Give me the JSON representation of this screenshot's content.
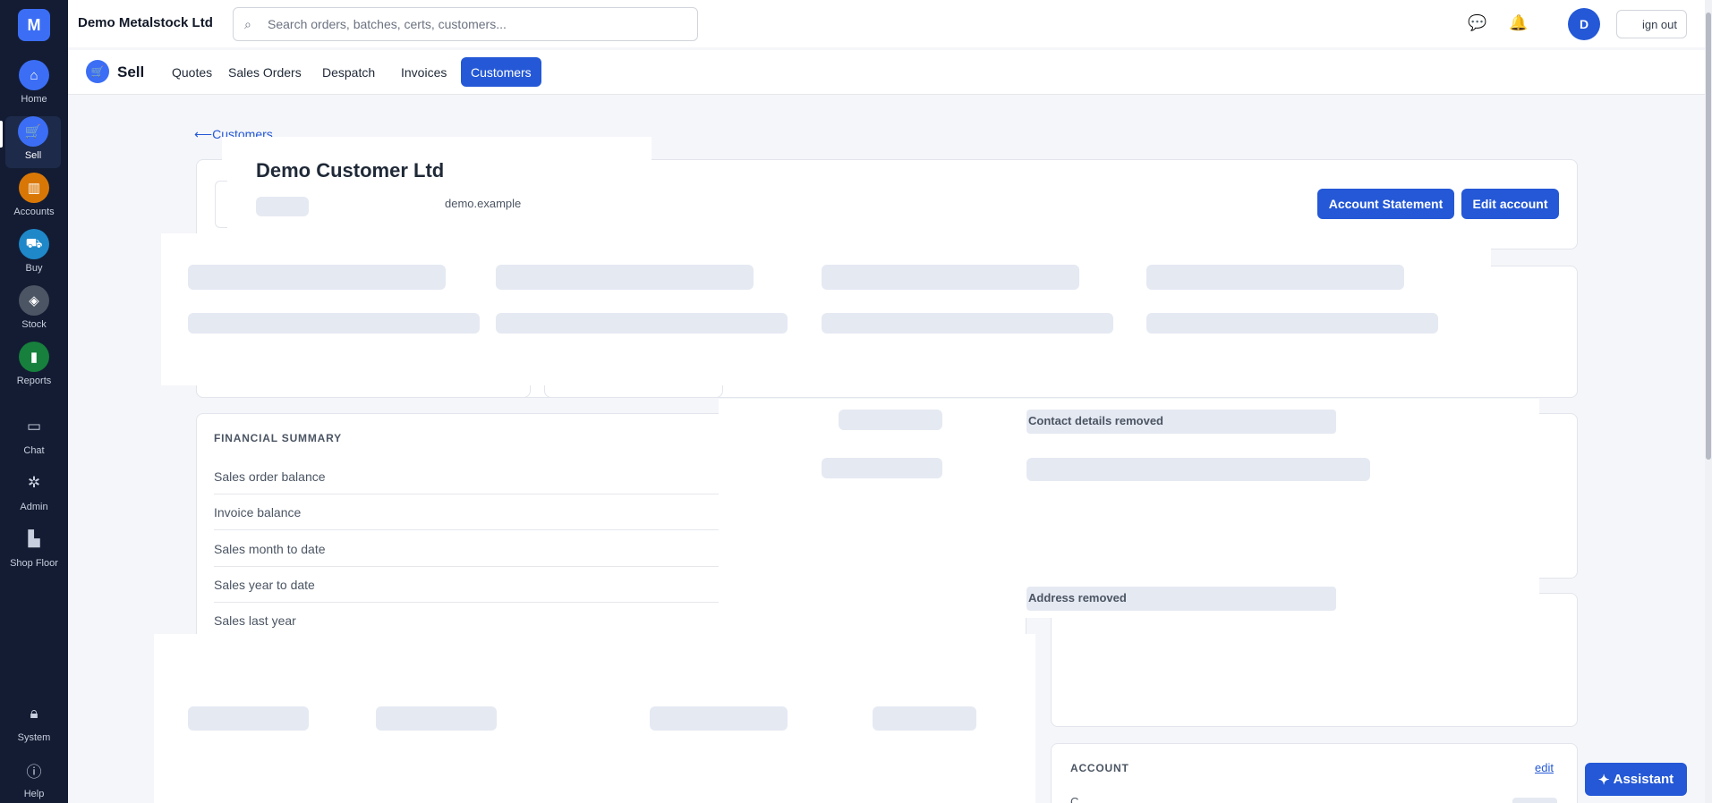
{
  "header": {
    "company": "Demo Metalstock Ltd",
    "search_placeholder": "Search orders, batches, certs, customers...",
    "avatar_initial": "D",
    "sign_out": "ign out"
  },
  "rail": {
    "brand": "M",
    "items": [
      {
        "label": "Home",
        "icon": "home-icon",
        "color": "#3b6ef5"
      },
      {
        "label": "Sell",
        "icon": "cart-icon",
        "color": "#3b6ef5"
      },
      {
        "label": "Accounts",
        "icon": "bank-icon",
        "color": "#d97706"
      },
      {
        "label": "Buy",
        "icon": "truck-icon",
        "color": "#1e88c9"
      },
      {
        "label": "Stock",
        "icon": "layers-icon",
        "color": "#4b5563"
      },
      {
        "label": "Reports",
        "icon": "bar-chart-icon",
        "color": "#16803c"
      },
      {
        "label": "Chat",
        "icon": "chat-icon"
      },
      {
        "label": "Admin",
        "icon": "gear-icon"
      },
      {
        "label": "Shop Floor",
        "icon": "factory-icon"
      },
      {
        "label": "System",
        "icon": "lock-icon"
      },
      {
        "label": "Help",
        "icon": "help-icon"
      }
    ]
  },
  "subnav": {
    "title": "Sell",
    "tabs": [
      "Quotes",
      "Sales Orders",
      "Despatch",
      "Invoices",
      "Customers"
    ],
    "active_tab": "Customers"
  },
  "customer": {
    "back_label": "Customers",
    "name": "Demo Customer Ltd",
    "domain": "demo.example",
    "statement_button": "Account Statement",
    "edit_button": "Edit account"
  },
  "financial_summary": {
    "title": "FINANCIAL SUMMARY",
    "rows": [
      "Sales order balance",
      "Invoice balance",
      "Sales month to date",
      "Sales year to date",
      "Sales last year"
    ]
  },
  "contacts": {
    "contact_placeholder": "Contact details removed",
    "address_placeholder": "Address removed"
  },
  "account": {
    "title": "ACCOUNT",
    "edit_link": "edit",
    "peek_label": "C.."
  },
  "assistant_label": "Assistant"
}
